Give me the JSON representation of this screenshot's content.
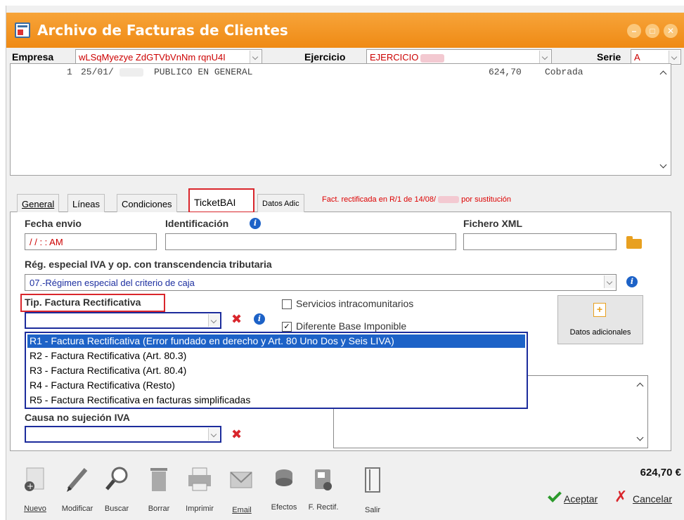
{
  "window": {
    "title": "Archivo de Facturas de Clientes",
    "buttons": [
      "minimize-icon",
      "maximize-icon",
      "close-icon"
    ]
  },
  "topbar": {
    "empresa_label": "Empresa",
    "empresa_value": "wLSqMyezye ZdGTVbVnNm rqnU4I",
    "ejercicio_label": "Ejercicio",
    "ejercicio_value": "EJERCICIO",
    "serie_label": "Serie",
    "serie_value": "A"
  },
  "invoices": [
    {
      "num": "1",
      "date": "25/01/",
      "client": "PUBLICO EN GENERAL",
      "amount": "624,70",
      "status": "Cobrada"
    }
  ],
  "tabs": [
    {
      "label": "General",
      "active": false
    },
    {
      "label": "Líneas",
      "active": false
    },
    {
      "label": "Condiciones",
      "active": false
    },
    {
      "label": "TicketBAI",
      "active": true
    },
    {
      "label": "Datos Adic",
      "active": false
    }
  ],
  "tab_note": {
    "prefix": "Fact. rectificada en R/1 de 14/08/",
    "suffix": "por sustitución"
  },
  "ticketbai": {
    "fecha_envio_label": "Fecha envio",
    "fecha_envio_value": " / /      :  :  AM",
    "identificacion_label": "Identificación",
    "identificacion_value": "",
    "fichero_label": "Fichero XML",
    "fichero_value": "",
    "reg_label": "Rég. especial IVA y op. con transcendencia tributaria",
    "reg_value": "07.-Régimen especial del criterio de caja",
    "tip_label": "Tip. Factura Rectificativa",
    "tip_value": "",
    "servicios_label": "Servicios intracomunitarios",
    "servicios_checked": false,
    "diferente_label": "Diferente Base Imponible",
    "diferente_checked": true,
    "datos_adicionales_label": "Datos adicionales",
    "causa_label": "Causa no sujeción IVA",
    "causa_value": ""
  },
  "dropdown_options": [
    "R1 - Factura Rectificativa (Error fundado en derecho y Art. 80 Uno Dos y Seis LIVA)",
    "R2 - Factura Rectificativa (Art. 80.3)",
    "R3 - Factura Rectificativa (Art. 80.4)",
    "R4 - Factura Rectificativa (Resto)",
    "R5 - Factura Rectificativa en facturas simplificadas"
  ],
  "dropdown_selected": 0,
  "toolbar": [
    {
      "label": "Nuevo",
      "icon": "new-doc-icon"
    },
    {
      "label": "Modificar",
      "icon": "pencil-icon"
    },
    {
      "label": "Buscar",
      "icon": "magnifier-icon"
    },
    {
      "label": "Borrar",
      "icon": "trash-icon"
    },
    {
      "label": "Imprimir",
      "icon": "printer-icon"
    },
    {
      "label": "Email",
      "icon": "email-icon"
    },
    {
      "label": "Efectos",
      "icon": "coins-icon"
    },
    {
      "label": "F. Rectif.",
      "icon": "rectify-doc-icon"
    },
    {
      "label": "Salir",
      "icon": "exit-door-icon"
    }
  ],
  "total": "624,70 €",
  "actions": {
    "accept": "Aceptar",
    "cancel": "Cancelar"
  },
  "colors": {
    "titlebar": "#ef8a14",
    "highlight": "#d9262c",
    "selection": "#1d62c7"
  }
}
